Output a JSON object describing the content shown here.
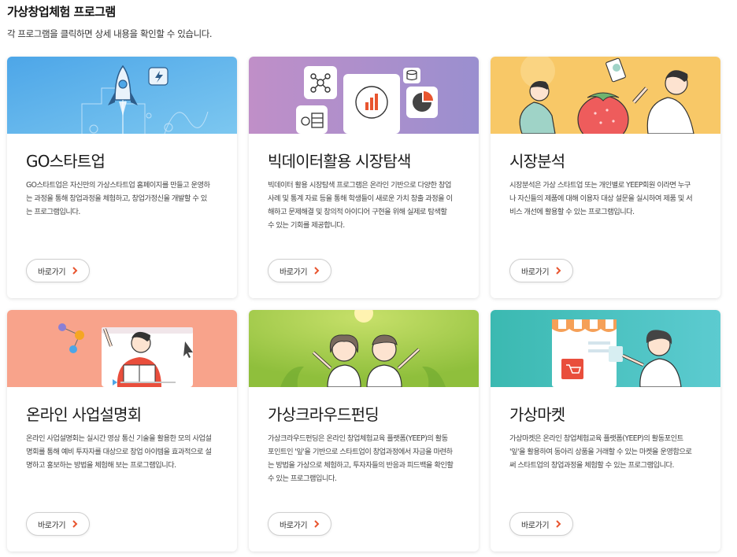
{
  "page": {
    "title": "가상창업체험 프로그램",
    "subtitle": "각 프로그램을 클릭하면 상세 내용을 확인할 수 있습니다."
  },
  "programs": [
    {
      "title": "GO스타트업",
      "description": "GO스타트업은 자신만의 가상스타트업 홈페이지를 만들고 운영하는 과정을 통해 창업과정을 체험하고, 창업가정신을 개발할 수 있는 프로그램입니다.",
      "button": "바로가기",
      "color": "#5fb0e6"
    },
    {
      "title": "빅데이터활용 시장탐색",
      "description": "빅데이터 활용 시장탐색 프로그램은 온라인 기반으로 다양한 창업 사례 및 통계 자료 등을 통해 학생들이 새로운 가치 창출 과정을 이해하고 문제해결 및 창의적 아이디어 구현을 위해 실제로 탐색할 수 있는 기회를 제공합니다.",
      "button": "바로가기",
      "color": "#b98fc9"
    },
    {
      "title": "시장분석",
      "description": "시장분석은 가상 스타트업 또는 개인별로 YEEP회원 이라면 누구나 자신들의 제품에 대해 이용자 대상 설문을 실시하여 제품 및 서비스 개선에 활용할 수 있는 프로그램입니다.",
      "button": "바로가기",
      "color": "#f7ca6e"
    },
    {
      "title": "온라인 사업설명회",
      "description": "온라인 사업설명회는 실시간 영상 통신 기술을 활용한 모의 사업설명회를 통해 예비 투자자를 대상으로 창업 아이템을 효과적으로 설명하고 홍보하는 방법을 체험해 보는 프로그램입니다.",
      "button": "바로가기",
      "color": "#f8a48a"
    },
    {
      "title": "가상크라우드펀딩",
      "description": "가상크라우드펀딩은 온라인 창업체험교육 플랫폼(YEEP)의 활동포인트인 '잎'을 기반으로 스타트업이 창업과정에서 자금을 마련하는 방법을 가상으로 체험하고, 투자자들의 반응과 피드백을 확인할 수 있는 프로그램입니다.",
      "button": "바로가기",
      "color": "#a3c945"
    },
    {
      "title": "가상마켓",
      "description": "가상마켓은 온라인 창업체험교육 플랫폼(YEEP)의 활동포인트 '잎'을 활용하여 동아리 상품을 거래할 수 있는 마켓을 운영함으로써 스타트업의 창업과정을 체험할 수 있는 프로그램입니다.",
      "button": "바로가기",
      "color": "#4cc3bc"
    }
  ]
}
